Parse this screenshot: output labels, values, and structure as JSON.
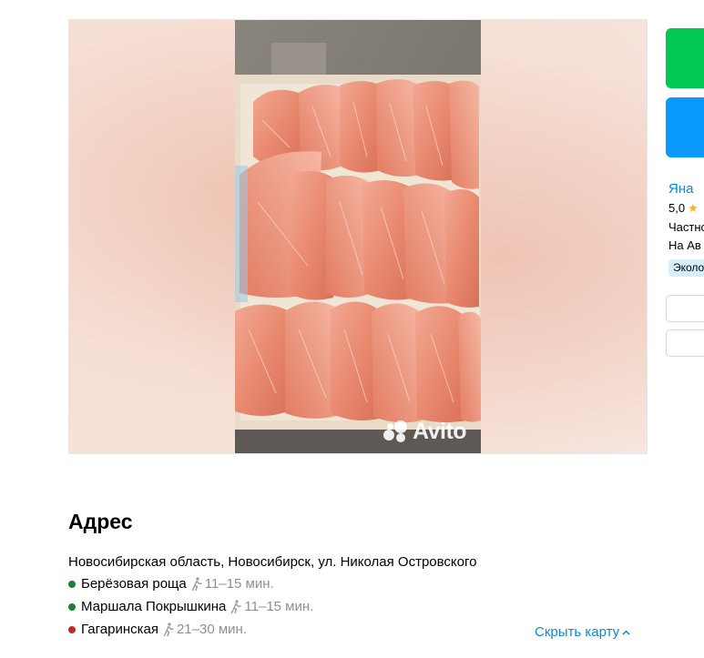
{
  "gallery": {
    "watermark": "Avito",
    "photo_subject": "frozen-fish-in-box"
  },
  "seller": {
    "name": "Яна",
    "rating": "5,0",
    "type": "Частно",
    "since": "На Ав",
    "badge": "Эколо"
  },
  "address": {
    "title": "Адрес",
    "line": "Новосибирская область, Новосибирск, ул. Николая Островского",
    "metro": [
      {
        "name": "Берёзовая роща",
        "time": "11–15 мин.",
        "color": "#1a7f37"
      },
      {
        "name": "Маршала Покрышкина",
        "time": "11–15 мин.",
        "color": "#1a7f37"
      },
      {
        "name": "Гагаринская",
        "time": "21–30 мин.",
        "color": "#c62828"
      }
    ],
    "hide_map": "Скрыть карту"
  },
  "colors": {
    "link": "#0a8ad6",
    "call_button": "#00c853",
    "message_button": "#0a99ff"
  }
}
